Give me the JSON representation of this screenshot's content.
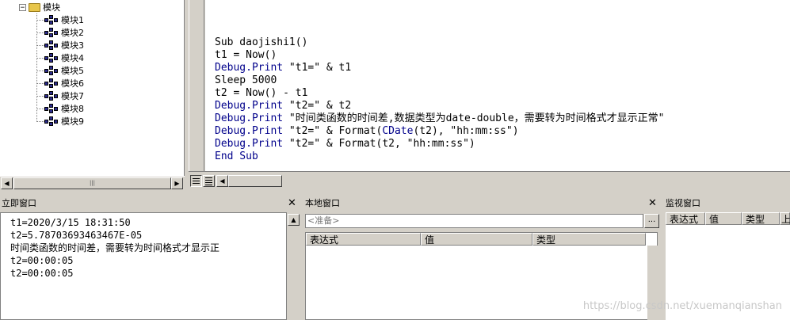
{
  "tree": {
    "root_label": "模块",
    "expander_glyph": "−",
    "modules": [
      "模块1",
      "模块2",
      "模块3",
      "模块4",
      "模块5",
      "模块6",
      "模块7",
      "模块8",
      "模块9"
    ]
  },
  "code": {
    "lines": [
      [
        {
          "t": "Sub daojishi1()",
          "c": ""
        }
      ],
      [
        {
          "t": "t1 = Now()",
          "c": ""
        }
      ],
      [
        {
          "t": "Debug.Print",
          "c": "kw"
        },
        {
          "t": " \"t1=\" & t1",
          "c": ""
        }
      ],
      [
        {
          "t": "Sleep 5000",
          "c": ""
        }
      ],
      [
        {
          "t": "t2 = Now() - t1",
          "c": ""
        }
      ],
      [
        {
          "t": "Debug.Print",
          "c": "kw"
        },
        {
          "t": " \"t2=\" & t2",
          "c": ""
        }
      ],
      [
        {
          "t": "Debug.Print",
          "c": "kw"
        },
        {
          "t": " \"时间类函数的时间差,数据类型为date-double，需要转为时间格式才显示正常\"",
          "c": ""
        }
      ],
      [
        {
          "t": "Debug.Print",
          "c": "kw"
        },
        {
          "t": " \"t2=\" & Format(",
          "c": ""
        },
        {
          "t": "CDate",
          "c": "kw"
        },
        {
          "t": "(t2), \"hh:mm:ss\")",
          "c": ""
        }
      ],
      [
        {
          "t": "Debug.Print",
          "c": "kw"
        },
        {
          "t": " \"t2=\" & Format(t2, \"hh:mm:ss\")",
          "c": ""
        }
      ],
      [
        {
          "t": "End Sub",
          "c": "kw"
        }
      ]
    ]
  },
  "immediate": {
    "title": "立即窗口",
    "lines": [
      "t1=2020/3/15 18:31:50",
      "t2=5.78703693463467E-05",
      "时间类函数的时间差，需要转为时间格式才显示正",
      "t2=00:00:05",
      "t2=00:00:05"
    ]
  },
  "locals": {
    "title": "本地窗口",
    "context": "<准备>",
    "more_label": "...",
    "columns": [
      "表达式",
      "值",
      "类型"
    ]
  },
  "watch": {
    "title": "监视窗口",
    "columns": [
      "表达式",
      "值",
      "类型",
      "上"
    ]
  },
  "watermark": "https://blog.csdn.net/xuemanqianshan",
  "glyphs": {
    "close": "✕",
    "left": "◀",
    "right": "▶",
    "up": "▲",
    "down": "▼",
    "thumb": "|||"
  }
}
